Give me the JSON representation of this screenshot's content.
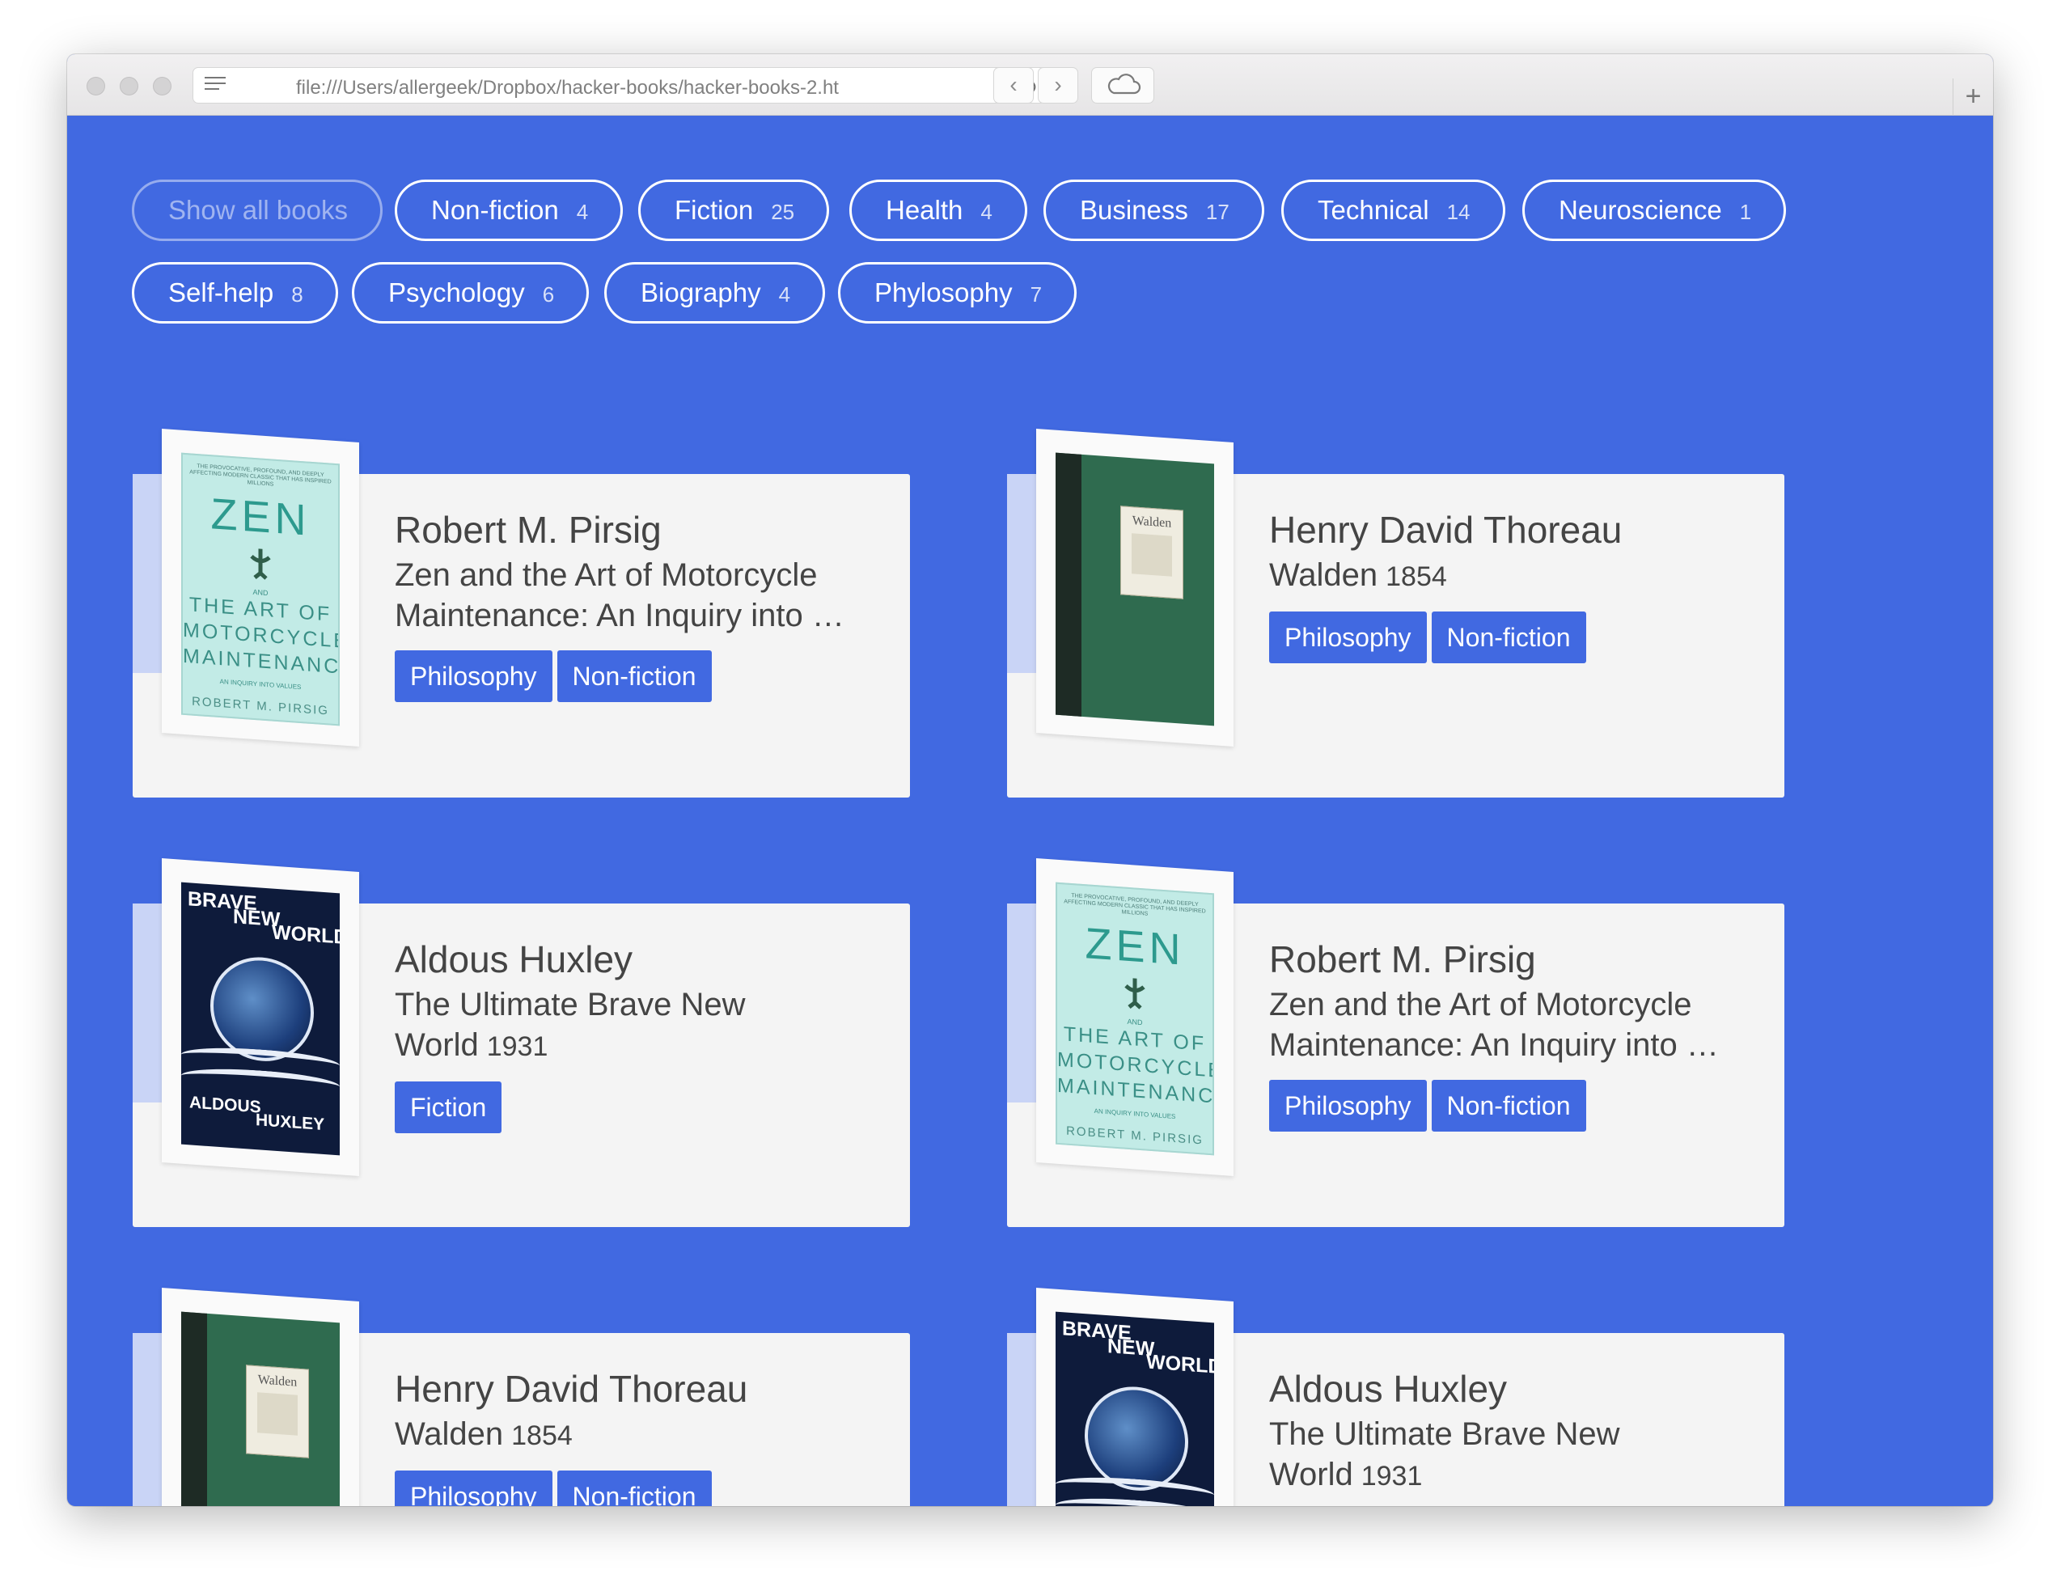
{
  "browser": {
    "url": "file:///Users/allergeek/Dropbox/hacker-books/hacker-books-2.ht"
  },
  "filters": [
    {
      "label": "Show all books",
      "count": ""
    },
    {
      "label": "Non-fiction",
      "count": "4"
    },
    {
      "label": "Fiction",
      "count": "25"
    },
    {
      "label": "Health",
      "count": "4"
    },
    {
      "label": "Business",
      "count": "17"
    },
    {
      "label": "Technical",
      "count": "14"
    },
    {
      "label": "Neuroscience",
      "count": "1"
    },
    {
      "label": "Self-help",
      "count": "8"
    },
    {
      "label": "Psychology",
      "count": "6"
    },
    {
      "label": "Biography",
      "count": "4"
    },
    {
      "label": "Phylosophy",
      "count": "7"
    }
  ],
  "books": [
    {
      "author": "Robert M. Pirsig",
      "title": "Zen and the Art of Motorcycle Maintenance: An Inquiry into …",
      "year": "",
      "tags": [
        "Philosophy",
        "Non-fiction"
      ],
      "cover": "zen"
    },
    {
      "author": "Henry David Thoreau",
      "title": "Walden",
      "year": "1854",
      "tags": [
        "Philosophy",
        "Non-fiction"
      ],
      "cover": "walden"
    },
    {
      "author": "Aldous Huxley",
      "title": "The Ultimate Brave New World",
      "year": "1931",
      "tags": [
        "Fiction"
      ],
      "cover": "bnw"
    },
    {
      "author": "Robert M. Pirsig",
      "title": "Zen and the Art of Motorcycle Maintenance: An Inquiry into …",
      "year": "",
      "tags": [
        "Philosophy",
        "Non-fiction"
      ],
      "cover": "zen"
    },
    {
      "author": "Henry David Thoreau",
      "title": "Walden",
      "year": "1854",
      "tags": [
        "Philosophy",
        "Non-fiction"
      ],
      "cover": "walden"
    },
    {
      "author": "Aldous Huxley",
      "title": "The Ultimate Brave New World",
      "year": "1931",
      "tags": [],
      "cover": "bnw"
    }
  ],
  "covers": {
    "zen": {
      "tagline": "THE PROVOCATIVE, PROFOUND, AND DEEPLY AFFECTING MODERN CLASSIC THAT HAS INSPIRED MILLIONS",
      "word1": "ZEN",
      "and": "AND",
      "art1": "THE ART OF",
      "art2": "MOTORCYCLE",
      "art3": "MAINTENANCE",
      "subtitle": "AN INQUIRY INTO VALUES",
      "author": "ROBERT M. PIRSIG"
    },
    "walden": {
      "title": "Walden"
    },
    "bnw": {
      "brave": "BRAVE",
      "new": "NEW",
      "world": "WORLD",
      "aldous": "ALDOUS",
      "huxley": "HUXLEY"
    }
  },
  "colors": {
    "background": "#4169e1",
    "card": "#f4f4f4",
    "tag": "#4169e1",
    "text": "#444444"
  }
}
